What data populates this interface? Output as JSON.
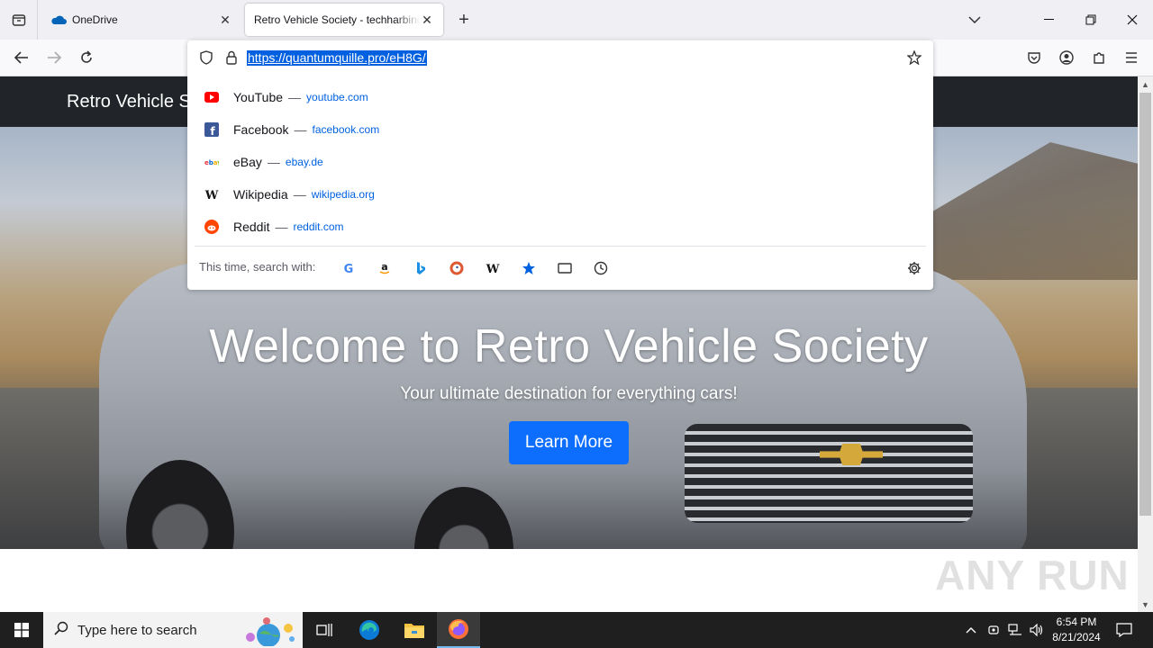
{
  "browser": {
    "tabs": [
      {
        "title": "OneDrive"
      },
      {
        "title": "Retro Vehicle Society - techharbinger"
      }
    ],
    "address": {
      "value": "https://quantumquille.pro/eH8G/"
    }
  },
  "suggestions": [
    {
      "name": "YouTube",
      "url": "youtube.com"
    },
    {
      "name": "Facebook",
      "url": "facebook.com"
    },
    {
      "name": "eBay",
      "url": "ebay.de"
    },
    {
      "name": "Wikipedia",
      "url": "wikipedia.org"
    },
    {
      "name": "Reddit",
      "url": "reddit.com"
    }
  ],
  "search_with": {
    "label": "This time, search with:"
  },
  "site": {
    "brand": "Retro Vehicle Society",
    "hero_title": "Welcome to Retro Vehicle Society",
    "hero_subtitle": "Your ultimate destination for everything cars!",
    "cta": "Learn More"
  },
  "watermark": "ANY RUN",
  "taskbar": {
    "search_placeholder": "Type here to search",
    "time": "6:54 PM",
    "date": "8/21/2024"
  },
  "colors": {
    "accent": "#0060df",
    "cta": "#0d6efd",
    "header": "#212529",
    "taskbar": "#1f1f1f"
  }
}
